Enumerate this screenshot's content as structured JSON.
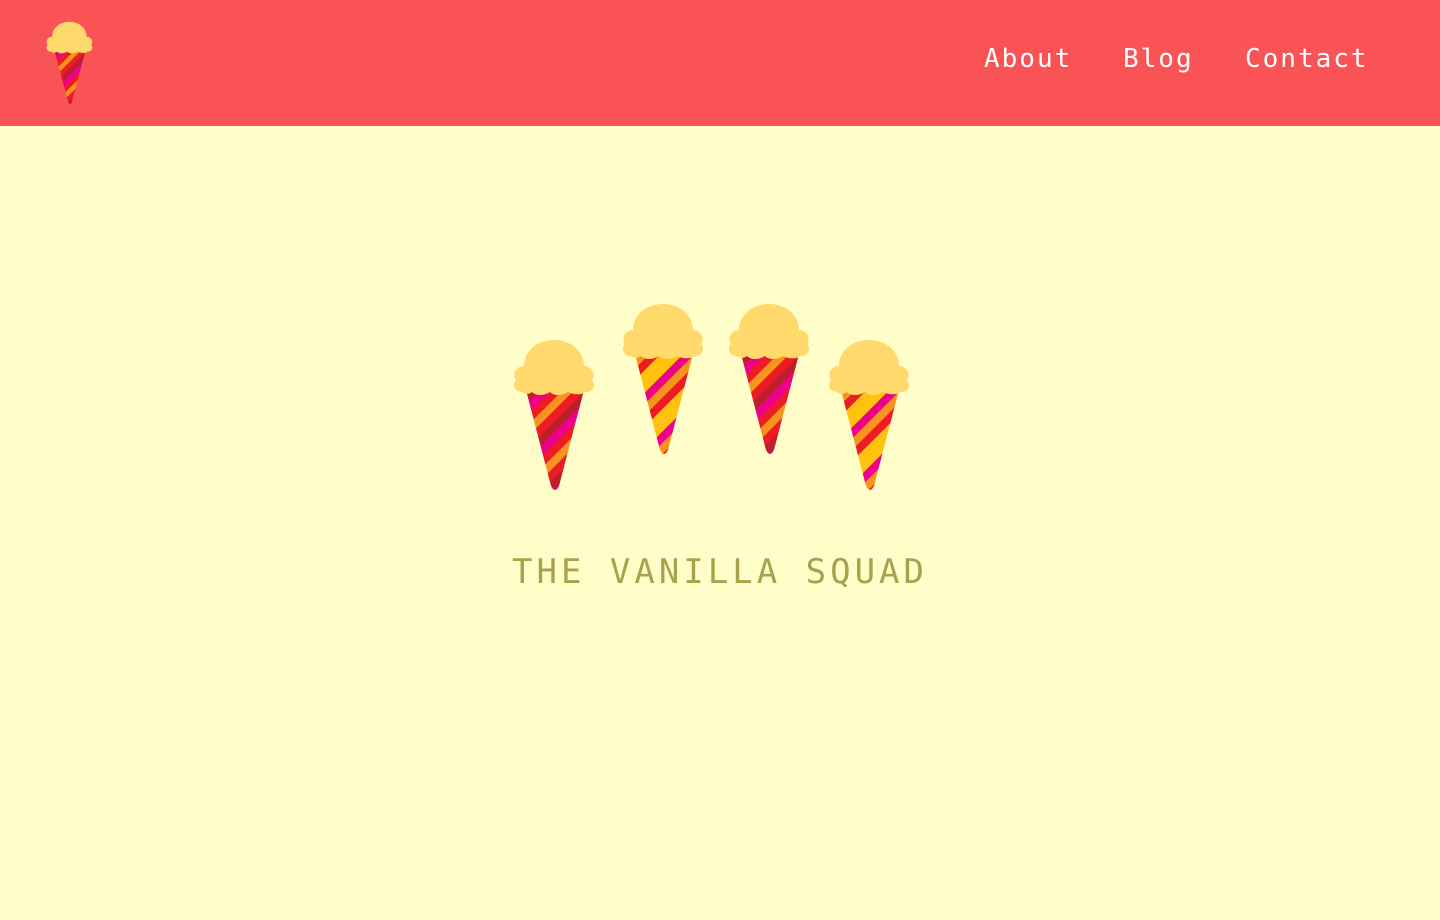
{
  "header": {
    "logo_icon": "ice-cream-cone-icon",
    "nav": [
      {
        "label": "About"
      },
      {
        "label": "Blog"
      },
      {
        "label": "Contact"
      }
    ]
  },
  "hero": {
    "illustration": "four-ice-cream-cones",
    "tagline": "THE VANILLA SQUAD"
  },
  "colors": {
    "header_bg": "#F95356",
    "page_bg": "#FFFEC8",
    "nav_text": "#FFFFFF",
    "tagline_text": "#A9A24D",
    "scoop": "#FFD96B",
    "cone_stripes": [
      "#ED1C24",
      "#F7941D",
      "#EC008C",
      "#BE1E2D",
      "#FFC20E"
    ]
  }
}
